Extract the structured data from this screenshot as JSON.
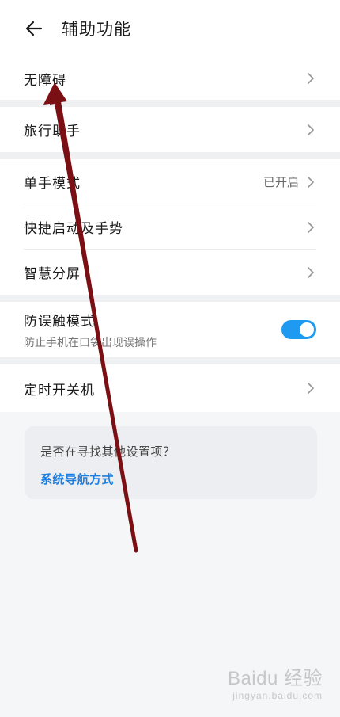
{
  "header": {
    "title": "辅助功能"
  },
  "items": {
    "accessibility": {
      "label": "无障碍"
    },
    "travel": {
      "label": "旅行助手"
    },
    "one_hand": {
      "label": "单手模式",
      "value": "已开启"
    },
    "quick_launch": {
      "label": "快捷启动及手势"
    },
    "split_screen": {
      "label": "智慧分屏"
    },
    "mistouch": {
      "label": "防误触模式",
      "sub": "防止手机在口袋出现误操作",
      "toggle_on": true
    },
    "scheduled_power": {
      "label": "定时开关机"
    }
  },
  "suggest": {
    "question": "是否在寻找其他设置项？",
    "link": "系统导航方式"
  },
  "watermark": {
    "brand": "Baidu 经验",
    "site": "jingyan.baidu.com"
  },
  "colors": {
    "accent": "#1e9bf0",
    "link": "#1e7fe0",
    "annotation_arrow": "#7a0f14"
  },
  "icons": {
    "back": "arrow-left-icon",
    "chevron": "chevron-right-icon"
  }
}
